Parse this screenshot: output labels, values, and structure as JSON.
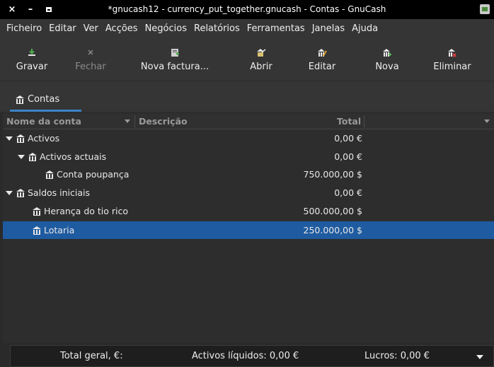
{
  "window": {
    "title": "*gnucash12 - currency_put_together.gnucash - Contas - GnuCash",
    "close_glyph": "×",
    "min_glyph": "–"
  },
  "menubar": {
    "items": [
      "Ficheiro",
      "Editar",
      "Ver",
      "Acções",
      "Negócios",
      "Relatórios",
      "Ferramentas",
      "Janelas",
      "Ajuda"
    ]
  },
  "toolbar": {
    "save": "Gravar",
    "close": "Fechar",
    "new_invoice": "Nova factura...",
    "open": "Abrir",
    "edit": "Editar",
    "new": "Nova",
    "delete": "Eliminar"
  },
  "tabs": [
    {
      "label": "Contas",
      "icon": "account-icon"
    }
  ],
  "table": {
    "columns": {
      "name": "Nome da conta",
      "description": "Descrição",
      "total": "Total"
    },
    "rows": [
      {
        "name": "Activos",
        "total": "0,00 €",
        "expanded": true
      },
      {
        "name": "Activos actuais",
        "total": "0,00 €",
        "expanded": true
      },
      {
        "name": "Conta poupança",
        "total": "750.000,00 $"
      },
      {
        "name": "Saldos iniciais",
        "total": "0,00 €",
        "expanded": true
      },
      {
        "name": "Herança do tio rico",
        "total": "500.000,00 $"
      },
      {
        "name": "Lotaria",
        "total": "250.000,00 $",
        "selected": true
      }
    ]
  },
  "footer": {
    "grand_total": "Total geral, €:",
    "net_assets": "Activos líquidos: 0,00 €",
    "profits": "Lucros: 0,00 €"
  },
  "colors": {
    "selection": "#1f5ba0",
    "tab_accent": "#3d84c6",
    "background": "#2d2d2d"
  }
}
